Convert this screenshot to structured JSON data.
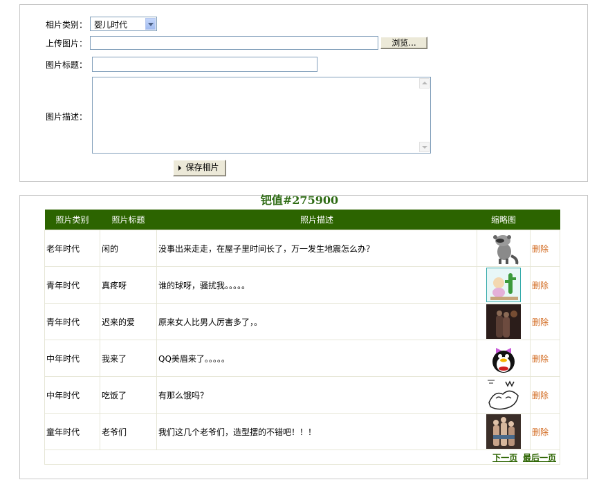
{
  "form": {
    "category_label": "相片类别：",
    "category_value": "婴儿时代",
    "upload_label": "上传图片：",
    "upload_value": "",
    "browse_label": "浏览...",
    "title_label": "图片标题：",
    "title_value": "",
    "desc_label": "图片描述：",
    "desc_value": "",
    "save_label": "保存相片"
  },
  "list": {
    "heading": "钯值#275900",
    "columns": [
      "照片类别",
      "照片标题",
      "照片描述",
      "缩略图",
      ""
    ],
    "rows": [
      {
        "category": "老年时代",
        "title": "闲的",
        "desc": "没事出来走走，在屋子里时间长了，万一发生地震怎么办？",
        "thumb": "raccoon-thumbnail",
        "delete": "删除"
      },
      {
        "category": "青年时代",
        "title": "真疼呀",
        "desc": "谁的球呀，骚扰我。。。。。",
        "thumb": "cactus-cartoon-thumbnail",
        "delete": "删除"
      },
      {
        "category": "青年时代",
        "title": "迟来的爱",
        "desc": "原来女人比男人厉害多了，。",
        "thumb": "couple-night-thumbnail",
        "delete": "删除"
      },
      {
        "category": "中年时代",
        "title": "我来了",
        "desc": "QQ美眉来了。。。。。",
        "thumb": "qq-penguin-thumbnail",
        "delete": "删除"
      },
      {
        "category": "中年时代",
        "title": "吃饭了",
        "desc": "有那么饿吗？",
        "thumb": "sketch-thumbnail",
        "delete": "删除"
      },
      {
        "category": "童年时代",
        "title": "老爷们",
        "desc": "我们这几个老爷们，造型摆的不错吧！！！",
        "thumb": "group-photo-thumbnail",
        "delete": "删除"
      }
    ],
    "pager": {
      "next": "下一页",
      "last": "最后一页"
    }
  }
}
